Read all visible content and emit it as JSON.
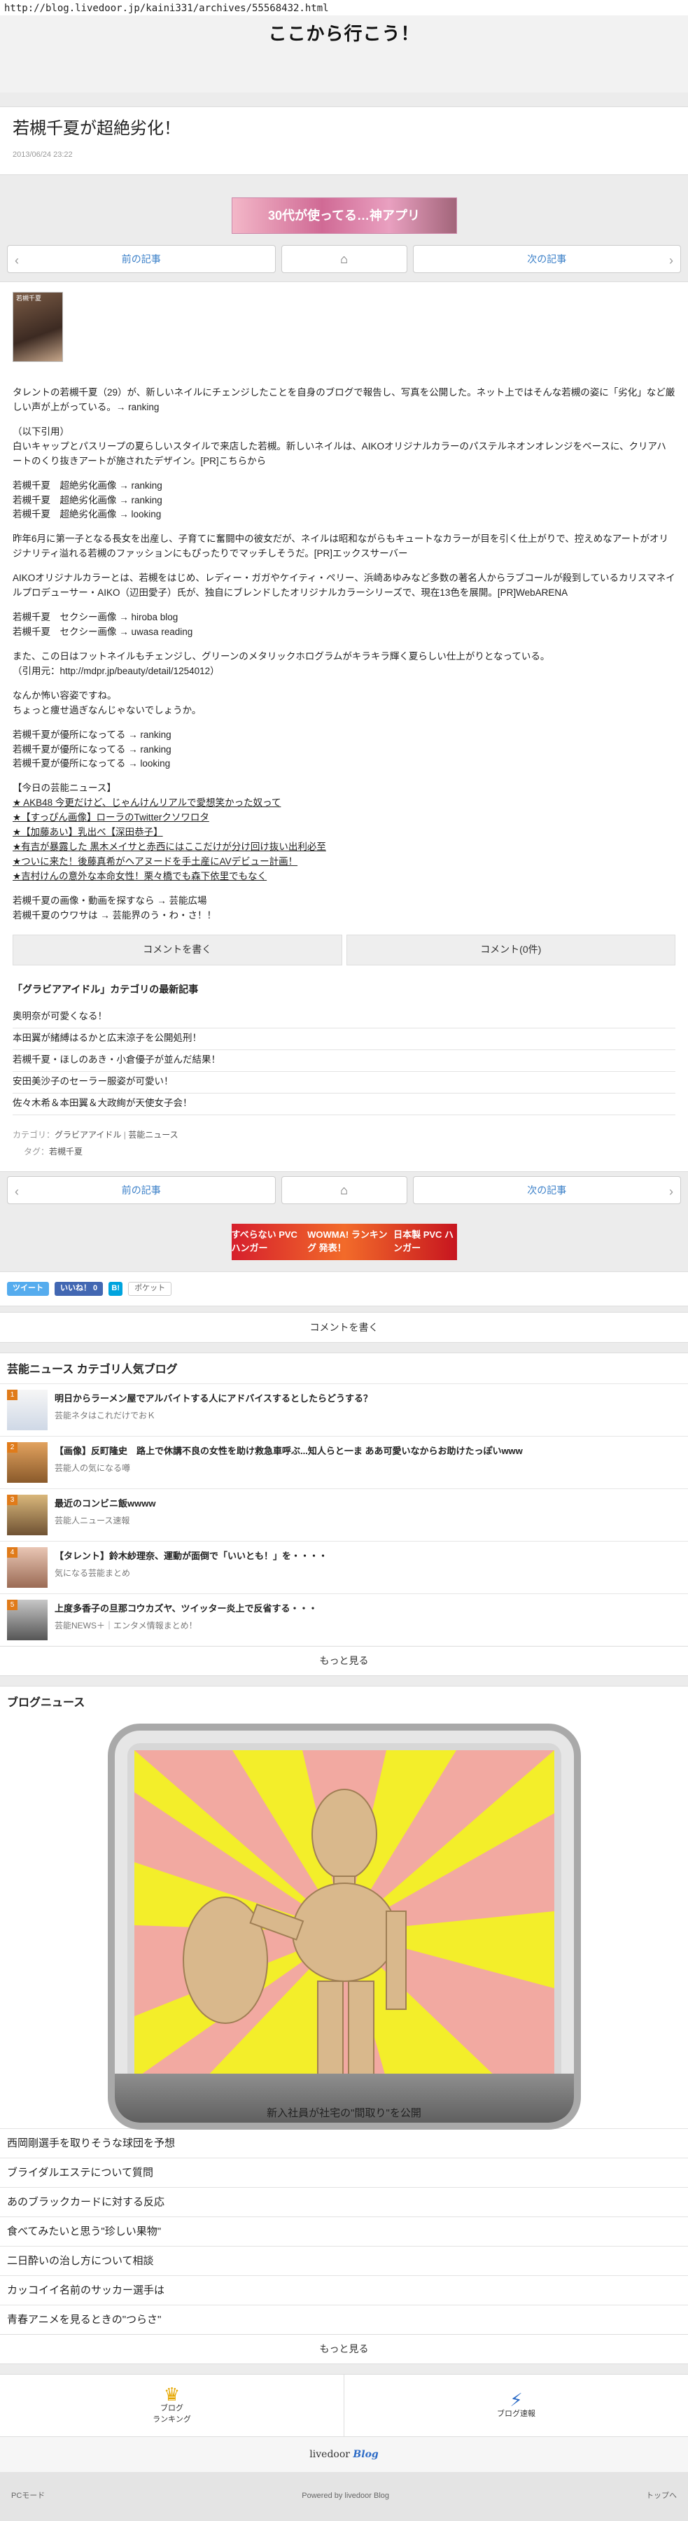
{
  "url": "http://blog.livedoor.jp/kaini331/archives/55568432.html",
  "site_title": "ここから行こう！",
  "article": {
    "title": "若槻千夏が超絶劣化！",
    "date": "2013/06/24 23:22"
  },
  "ad_top": {
    "text": "30代が使ってる…神アプリ"
  },
  "pager": {
    "prev": "前の記事",
    "next": "次の記事"
  },
  "body": {
    "thumb_caption": "若槻千夏",
    "p1": "タレントの若槻千夏（29）が、新しいネイルにチェンジしたことを自身のブログで報告し、写真を公開した。ネット上ではそんな若槻の姿に「劣化」など厳しい声が上がっている。→ ranking",
    "p2": "（以下引用）\n白いキャップとパスリープの夏らしいスタイルで来店した若槻。新しいネイルは、AIKOオリジナルカラーのパステルネオンオレンジをベースに、クリアハートのくり抜きアートが施されたデザイン。[PR]こちらから",
    "links1": [
      "若槻千夏　超絶劣化画像 → ranking",
      "若槻千夏　超絶劣化画像 → ranking",
      "若槻千夏　超絶劣化画像 → looking"
    ],
    "p3": "昨年6月に第一子となる長女を出産し、子育てに奮闘中の彼女だが、ネイルは昭和ながらもキュートなカラーが目を引く仕上がりで、控えめなアートがオリジナリティ溢れる若槻のファッションにもぴったりでマッチしそうだ。[PR]エックスサーバー",
    "p4": "AIKOオリジナルカラーとは、若槻をはじめ、レディー・ガガやケイティ・ペリー、浜崎あゆみなど多数の著名人からラブコールが殺到しているカリスマネイルプロデューサー・AIKO（辺田愛子）氏が、独自にブレンドしたオリジナルカラーシリーズで、現在13色を展開。[PR]WebARENA",
    "links2": [
      "若槻千夏　セクシー画像 → hiroba blog",
      "若槻千夏　セクシー画像 → uwasa reading"
    ],
    "p5": "また、この日はフットネイルもチェンジし、グリーンのメタリックホログラムがキラキラ輝く夏らしい仕上がりとなっている。\n（引用元：http://mdpr.jp/beauty/detail/1254012）",
    "p6": "なんか怖い容姿ですね。\nちょっと痩せ過ぎなんじゃないでしょうか。",
    "links3": [
      "若槻千夏が優所になってる → ranking",
      "若槻千夏が優所になってる → ranking",
      "若槻千夏が優所になってる → looking"
    ],
    "news_head": "【今日の芸能ニュース】",
    "news": [
      "★ AKB48 今更だけど、じゃんけんリアルで愛想笑かった奴って",
      "★【すっぴん画像】ローラのTwitterクソワロタ",
      "★【加藤あい】乳出べ【深田恭子】",
      "★有吉が暴露した 黒木メイサと赤西にはここだけが分け回け抜い出利必至",
      "★ついに来た！後藤真希がヘアヌードを手土産にAVデビュー計画！",
      "★吉村けんの意外な本命女性！栗々橋でも森下依里でもなく"
    ],
    "links4": [
      "若槻千夏の画像・動画を探すなら → 芸能広場",
      "若槻千夏のウワサは → 芸能界のう・わ・さ！！"
    ]
  },
  "comment_buttons": {
    "write": "コメントを書く",
    "count": "コメント(0件)"
  },
  "category": {
    "head": "「グラビアアイドル」カテゴリの最新記事",
    "items": [
      "奥明奈が可愛くなる！",
      "本田翼が緒縛はるかと広末涼子を公開処刑！",
      "若槻千夏・ほしのあき・小倉優子が並んだ結果！",
      "安田美沙子のセーラー服姿が可愛い！",
      "佐々木希＆本田翼＆大政絢が天使女子会！"
    ]
  },
  "meta": {
    "cat_label": "カテゴリ：",
    "cat": "グラビアアイドル",
    "cat2": "芸能ニュース",
    "tag_label": "タグ：",
    "tag": "若槻千夏"
  },
  "ad_bottom": {
    "a": "すべらない PVC ハンガー",
    "b": "WOWMA! ランキング 発表！",
    "c": "日本製 PVC ハンガー"
  },
  "social": {
    "tweet": "ツイート",
    "like": "いいね！ 0",
    "hatena": "B!",
    "pocket": "ポケット"
  },
  "comment_bar": "コメントを書く",
  "popular": {
    "title": "芸能ニュース カテゴリ人気ブログ",
    "items": [
      {
        "rank": "1",
        "title": "明日からラーメン屋でアルバイトする人にアドバイスするとしたらどうする？",
        "src": "芸能ネタはこれだけでおＫ"
      },
      {
        "rank": "2",
        "title": "【画像】反町隆史　路上で休講不良の女性を助け救急車呼ぶ...知人らと一ま ああ可愛いなからお助けたっぽいwww",
        "src": "芸能人の気になる噂"
      },
      {
        "rank": "3",
        "title": "最近のコンビニ飯wwww",
        "src": "芸能人ニュース速報"
      },
      {
        "rank": "4",
        "title": "【タレント】鈴木紗理奈、運動が面倒で「いいとも！」を・・・・",
        "src": "気になる芸能まとめ"
      },
      {
        "rank": "5",
        "title": "上度多香子の旦那コウカズヤ、ツイッター炎上で反省する・・・",
        "src": "芸能NEWS＋｜エンタメ情報まとめ！"
      }
    ],
    "more": "もっと見る"
  },
  "blog_news": {
    "title": "ブログニュース",
    "hero_caption": "新入社員が社宅の\"間取り\"を公開",
    "items": [
      "西岡剛選手を取りそうな球団を予想",
      "ブライダルエステについて質問",
      "あのブラックカードに対する反応",
      "食べてみたいと思う\"珍しい果物\"",
      "二日酔いの治し方について相談",
      "カッコイイ名前のサッカー選手は",
      "青春アニメを見るときの\"つらさ\""
    ],
    "more": "もっと見る"
  },
  "footer_links": {
    "ranking": "ブログ\nランキング",
    "news": "ブログ速報"
  },
  "logo": {
    "a": "livedoor",
    "b": "Blog"
  },
  "bottom": {
    "pc_mode": "PCモード",
    "powered": "Powered by livedoor Blog",
    "top": "トップへ"
  },
  "colors": {
    "link_blue": "#3a7fc8",
    "accent_orange": "#e07b1a"
  }
}
